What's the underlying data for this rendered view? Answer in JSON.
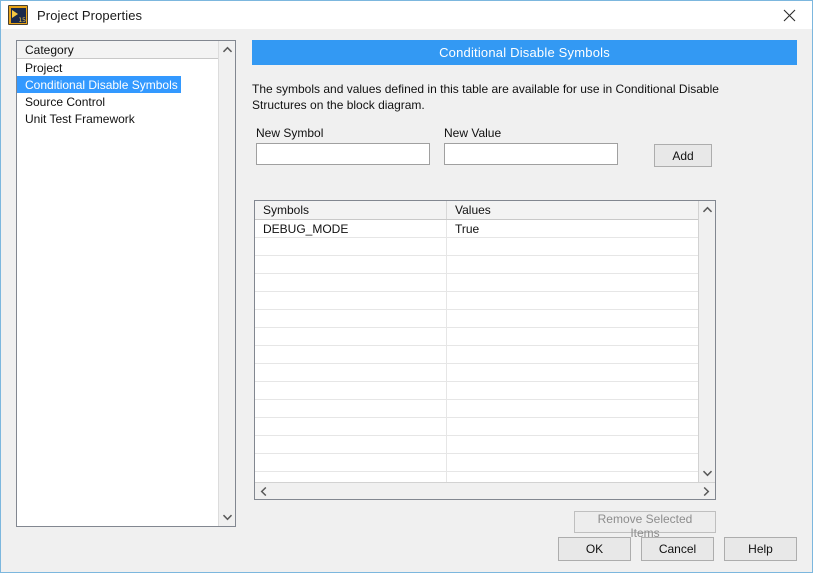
{
  "window": {
    "title": "Project Properties",
    "icon": "labview-project-icon",
    "icon_badge": "15",
    "close_label": "✕",
    "border_color": "#7cb7de"
  },
  "category_panel": {
    "header": "Category",
    "items": [
      {
        "label": "Project",
        "selected": false
      },
      {
        "label": "Conditional Disable Symbols",
        "selected": true
      },
      {
        "label": "Source Control",
        "selected": false
      },
      {
        "label": "Unit Test Framework",
        "selected": false
      }
    ],
    "scroll_up_icon": "chevron-up-icon",
    "scroll_down_icon": "chevron-down-icon"
  },
  "content": {
    "banner_title": "Conditional Disable Symbols",
    "banner_color": "#3399f3",
    "description": "The symbols and values defined in this table are available for use in Conditional Disable Structures on the block diagram.",
    "new_symbol": {
      "label": "New Symbol",
      "value": "",
      "placeholder": ""
    },
    "new_value": {
      "label": "New Value",
      "value": "",
      "placeholder": ""
    },
    "add_button": "Add",
    "table": {
      "columns": [
        "Symbols",
        "Values"
      ],
      "rows": [
        {
          "symbol": "DEBUG_MODE",
          "value": "True"
        },
        {
          "symbol": "",
          "value": ""
        },
        {
          "symbol": "",
          "value": ""
        },
        {
          "symbol": "",
          "value": ""
        },
        {
          "symbol": "",
          "value": ""
        },
        {
          "symbol": "",
          "value": ""
        },
        {
          "symbol": "",
          "value": ""
        },
        {
          "symbol": "",
          "value": ""
        },
        {
          "symbol": "",
          "value": ""
        },
        {
          "symbol": "",
          "value": ""
        },
        {
          "symbol": "",
          "value": ""
        },
        {
          "symbol": "",
          "value": ""
        },
        {
          "symbol": "",
          "value": ""
        },
        {
          "symbol": "",
          "value": ""
        },
        {
          "symbol": "",
          "value": ""
        }
      ],
      "scroll_up_icon": "chevron-up-icon",
      "scroll_down_icon": "chevron-down-icon",
      "scroll_left_icon": "chevron-left-icon",
      "scroll_right_icon": "chevron-right-icon"
    },
    "remove_button": {
      "label": "Remove Selected Items",
      "disabled": true
    }
  },
  "footer": {
    "ok": "OK",
    "cancel": "Cancel",
    "help": "Help"
  }
}
